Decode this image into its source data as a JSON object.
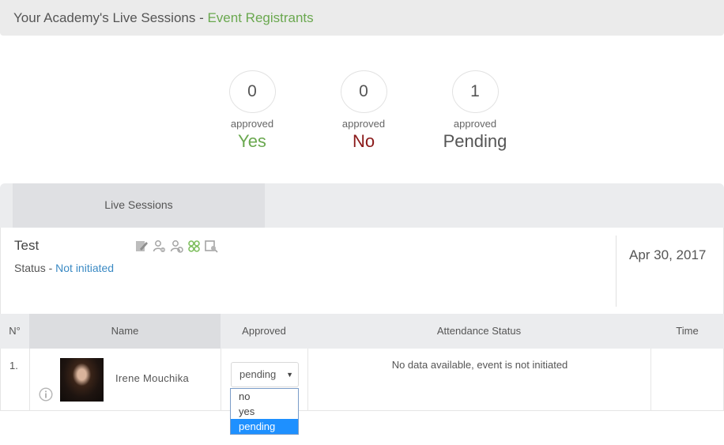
{
  "header": {
    "title": "Your Academy's Live Sessions - ",
    "subtitle": "Event Registrants"
  },
  "stats": [
    {
      "count": "0",
      "label": "approved",
      "value": "Yes",
      "color": "#6aa84f"
    },
    {
      "count": "0",
      "label": "approved",
      "value": "No",
      "color": "#8b1a1a"
    },
    {
      "count": "1",
      "label": "approved",
      "value": "Pending",
      "color": "#555555"
    }
  ],
  "tabs": [
    {
      "label": "Live Sessions",
      "active": true
    }
  ],
  "session": {
    "title": "Test",
    "status_label": "Status - ",
    "status_value": "Not initiated",
    "date": "Apr 30, 2017",
    "icons": [
      "edit-icon",
      "user-remove-icon",
      "user-settings-icon",
      "users-group-icon",
      "preview-icon"
    ]
  },
  "table": {
    "columns": [
      "N°",
      "Name",
      "Approved",
      "Attendance Status",
      "Time"
    ],
    "rows": [
      {
        "num": "1.",
        "name": "Irene Mouchika",
        "approved": "pending",
        "attendance": "No data available, event is not initiated",
        "time": ""
      }
    ]
  },
  "dropdown": {
    "options": [
      "no",
      "yes",
      "pending"
    ],
    "selected": "pending"
  },
  "colors": {
    "accent_green": "#6aa84f",
    "no_red": "#8b1a1a",
    "link_blue": "#3b8ac4",
    "selected_blue": "#1e90ff"
  }
}
